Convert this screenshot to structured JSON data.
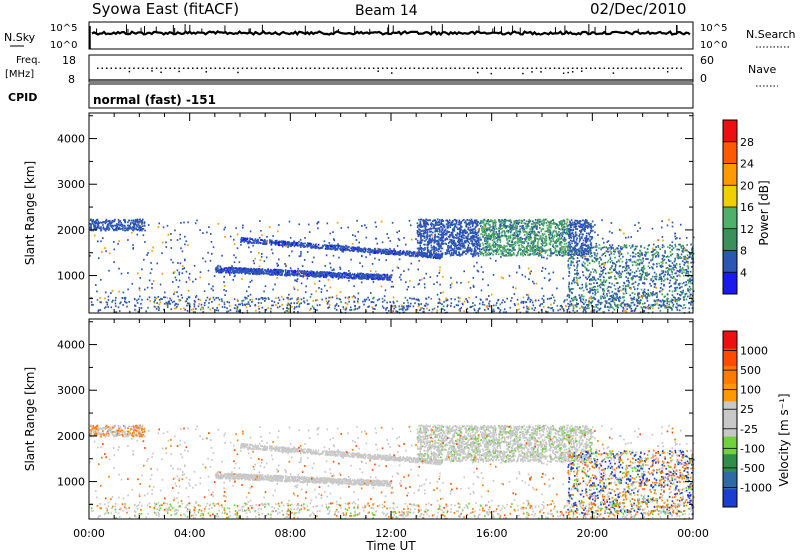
{
  "header": {
    "station": "Syowa East (fitACF)",
    "beam": "Beam 14",
    "date": "02/Dec/2010"
  },
  "summary_panels": {
    "nsky": {
      "label": "N.Sky",
      "ticks": [
        "10^5",
        "10^0"
      ]
    },
    "nsearch": {
      "label": "N.Search",
      "ticks": [
        "10^5",
        "10^0"
      ]
    },
    "freq": {
      "label_line1": "Freq.",
      "label_line2": "[MHz]",
      "ticks": [
        "18",
        "8"
      ]
    },
    "nave": {
      "label": "Nave",
      "ticks": [
        "60",
        "0"
      ]
    },
    "cpid": {
      "label": "CPID",
      "value": "normal (fast) -151"
    }
  },
  "colors": {
    "power_scale": [
      "#1a1aee",
      "#2d55b4",
      "#3b8f5a",
      "#4fb06a",
      "#f0d000",
      "#ff9a00",
      "#ff5a00",
      "#ee1010"
    ],
    "velocity_scale": [
      "#1a3fd0",
      "#2f6aa8",
      "#2f8f4a",
      "#6fd040",
      "#c8c8c8",
      "#c8c8c8",
      "#ff9900",
      "#ff7a00",
      "#ff4a00",
      "#ee1010"
    ]
  },
  "chart_data": [
    {
      "type": "heatmap",
      "title": "",
      "xlabel": "Time UT",
      "ylabel": "Slant Range [km]",
      "x_ticks": [
        "00:00",
        "04:00",
        "08:00",
        "12:00",
        "16:00",
        "20:00",
        "00:00"
      ],
      "x_range_hours": [
        0,
        24
      ],
      "y_ticks": [
        "1000",
        "2000",
        "3000",
        "4000"
      ],
      "ylim": [
        180,
        4560
      ],
      "colorbar": {
        "label": "Power [dB]",
        "ticks": [
          "4",
          "8",
          "12",
          "16",
          "20",
          "24",
          "28"
        ],
        "range": [
          0,
          32
        ]
      }
    },
    {
      "type": "heatmap",
      "title": "",
      "xlabel": "Time UT",
      "ylabel": "Slant Range [km]",
      "x_ticks": [
        "00:00",
        "04:00",
        "08:00",
        "12:00",
        "16:00",
        "20:00",
        "00:00"
      ],
      "x_range_hours": [
        0,
        24
      ],
      "y_ticks": [
        "1000",
        "2000",
        "3000",
        "4000"
      ],
      "ylim": [
        180,
        4560
      ],
      "colorbar": {
        "label": "Velocity [m s⁻¹]",
        "ticks": [
          "1000",
          "500",
          "100",
          "25",
          "-25",
          "-100",
          "-500",
          "-1000"
        ]
      }
    }
  ]
}
